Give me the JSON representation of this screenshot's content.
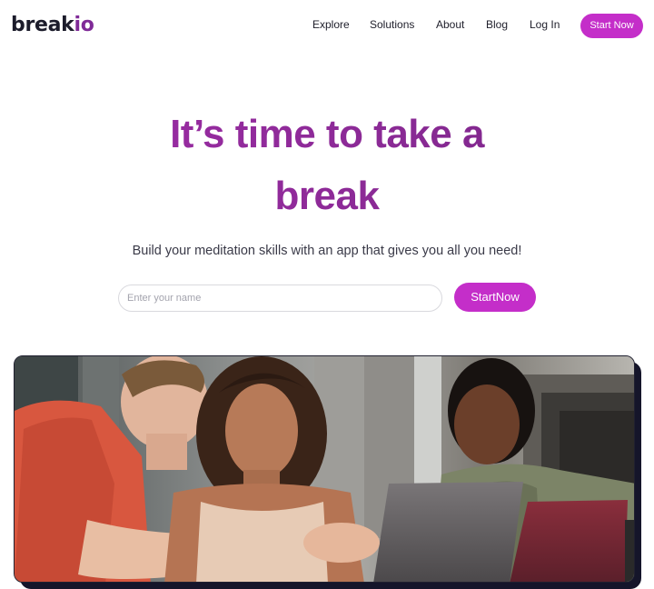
{
  "brand": {
    "name_part1": "break",
    "name_part2": "io"
  },
  "nav": {
    "items": [
      "Explore",
      "Solutions",
      "About",
      "Blog",
      "Log In"
    ],
    "cta_label": "Start Now"
  },
  "hero": {
    "title_line1": "It’s time to take a",
    "title_line2": "break",
    "subtitle": "Build your meditation skills with an app that gives you all you need!",
    "input_placeholder": "Enter your name",
    "input_value": "",
    "cta_label": "StartNow"
  },
  "colors": {
    "accent": "#c42ec9",
    "title": "#8f2698",
    "logo_dark": "#1c1c2b",
    "logo_accent": "#7f2a97"
  },
  "image": {
    "alt": "Three people looking at a laptop together"
  }
}
